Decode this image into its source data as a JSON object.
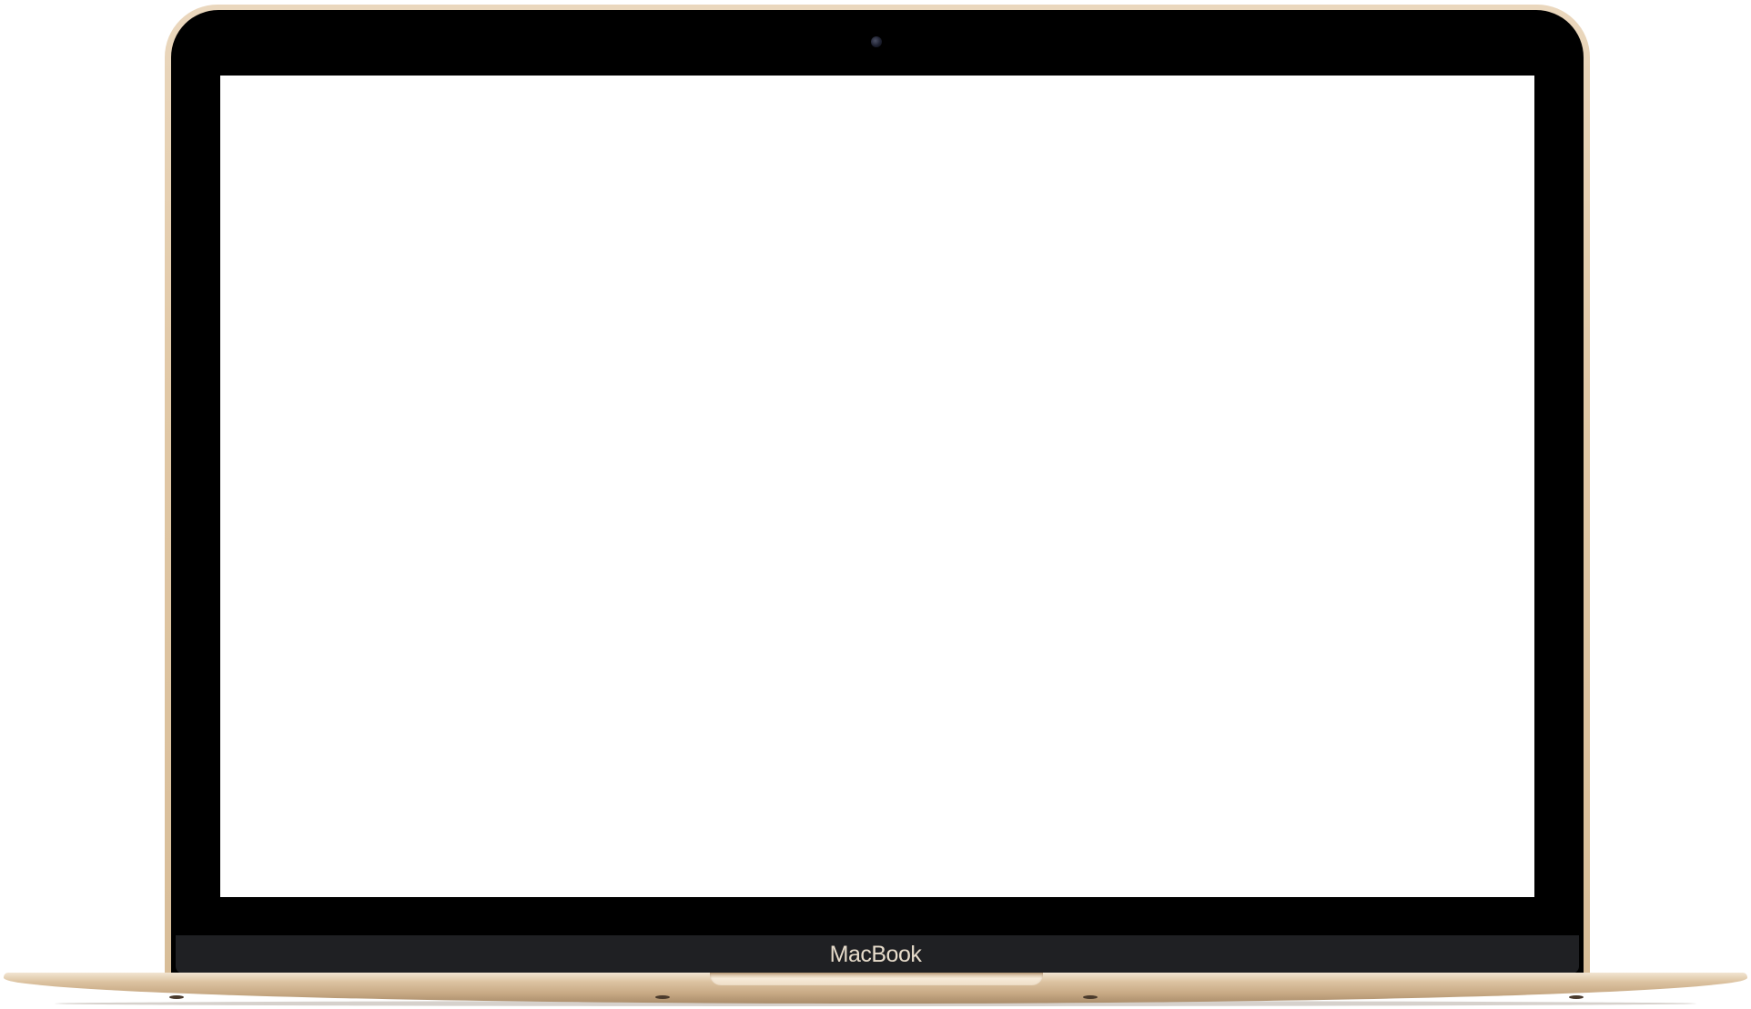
{
  "device": {
    "brand_label": "MacBook",
    "colors": {
      "frame": "#e1c8a6",
      "bezel": "#000000",
      "chin": "#1f2023",
      "label": "#e7dccb",
      "screen": "#ffffff"
    }
  },
  "screen": {
    "content": ""
  },
  "icons": [
    "camera-icon"
  ]
}
